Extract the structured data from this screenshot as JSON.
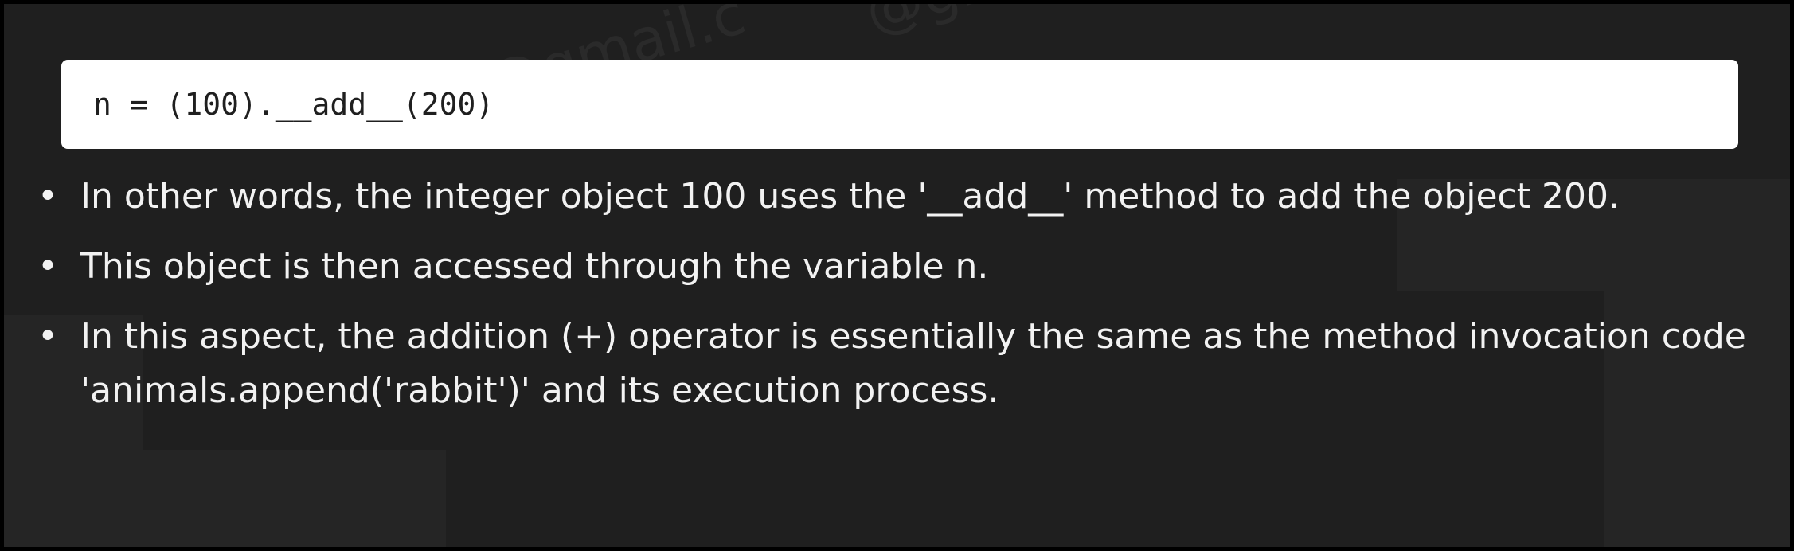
{
  "code": {
    "line": "n = (100).__add__(200)"
  },
  "bullets": [
    {
      "marker": "•",
      "text": "In other words, the integer object 100 uses the '__add__' method to add the object 200."
    },
    {
      "marker": "•",
      "text": "This object is then accessed through the variable n."
    },
    {
      "marker": "•",
      "text": "In this aspect, the addition (+) operator is essentially the same as the method invocation code 'animals.append('rabbit')' and its execution process."
    }
  ],
  "watermark": {
    "text_1": "@gmail.c",
    "text_2": "@gm"
  },
  "colors": {
    "background": "#1f1f1f",
    "code_background": "#ffffff",
    "text": "#f2f2f2"
  }
}
